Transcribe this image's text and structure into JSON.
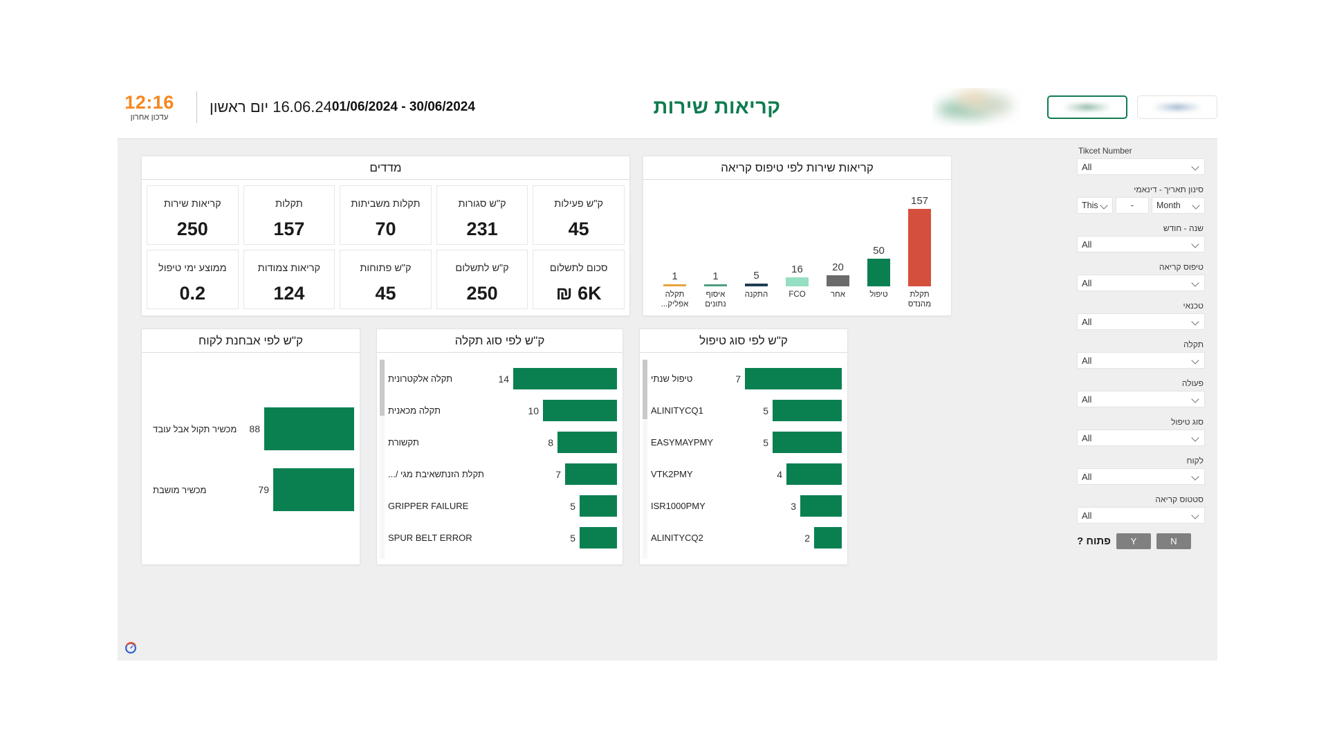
{
  "header": {
    "clock_time": "12:16",
    "clock_sub": "עדכון אחרון",
    "day_date": "16.06.24  יום ראשון",
    "date_range": "01/06/2024 - 30/06/2024",
    "title": "קריאות שירות",
    "button_secondary_label": "",
    "button_primary_label": "",
    "logo_name": "company-logo"
  },
  "kpi": {
    "title": "מדדים",
    "rows": [
      [
        {
          "label": "קריאות שירות",
          "value": "250"
        },
        {
          "label": "תקלות",
          "value": "157"
        },
        {
          "label": "תקלות משביתות",
          "value": "70"
        },
        {
          "label": "ק\"ש סגורות",
          "value": "231"
        },
        {
          "label": "ק\"ש פעילות",
          "value": "45"
        }
      ],
      [
        {
          "label": "ממוצע ימי טיפול",
          "value": "0.2"
        },
        {
          "label": "קריאות צמודות",
          "value": "124"
        },
        {
          "label": "ק\"ש פתוחות",
          "value": "45"
        },
        {
          "label": "ק\"ש לתשלום",
          "value": "250"
        },
        {
          "label": "סכום לתשלום",
          "value": "6K ₪"
        }
      ]
    ]
  },
  "chart_data": [
    {
      "id": "calls-by-type",
      "type": "bar",
      "orientation": "vertical",
      "title": "קריאות שירות לפי טיפוס קריאה",
      "xlabel": "",
      "ylabel": "",
      "ylim": [
        0,
        157
      ],
      "grid": false,
      "legend": "none",
      "categories": [
        "תקלת מהנדס",
        "טיפול",
        "אחר",
        "FCO",
        "התקנה",
        "איסוף נתונים",
        "תקלה אפליק..."
      ],
      "values": [
        157,
        50,
        20,
        16,
        5,
        1,
        1
      ],
      "colors": [
        "#D4503C",
        "#0A8050",
        "#6B6B6B",
        "#96DFC2",
        "#1E3D55",
        "#4F9E7E",
        "#E8A33D"
      ]
    },
    {
      "id": "calls-by-customer-diagnosis",
      "type": "bar",
      "orientation": "horizontal",
      "title": "ק\"ש לפי אבחנת לקוח",
      "xlabel": "",
      "ylabel": "",
      "xlim": [
        0,
        88
      ],
      "grid": false,
      "legend": "none",
      "categories": [
        "מכשיר תקול אבל עובד",
        "מכשיר מושבת"
      ],
      "values": [
        88,
        79
      ],
      "color": "#0A8050"
    },
    {
      "id": "calls-by-fault-type",
      "type": "bar",
      "orientation": "horizontal",
      "title": "ק\"ש לפי סוג תקלה",
      "xlabel": "",
      "ylabel": "",
      "xlim": [
        0,
        14
      ],
      "grid": false,
      "legend": "none",
      "scrollable": true,
      "categories": [
        "תקלה אלקטרונית",
        "תקלה מכאנית",
        "תקשורת",
        "תקלת הזנתשאיבת מגי /...",
        "GRIPPER FAILURE",
        "SPUR BELT ERROR"
      ],
      "values": [
        14,
        10,
        8,
        7,
        5,
        5
      ],
      "color": "#0A8050"
    },
    {
      "id": "calls-by-treatment-type",
      "type": "bar",
      "orientation": "horizontal",
      "title": "ק\"ש לפי סוג טיפול",
      "xlabel": "",
      "ylabel": "",
      "xlim": [
        0,
        7
      ],
      "grid": false,
      "legend": "none",
      "scrollable": true,
      "categories": [
        "טיפול שנתי",
        "ALINITYCQ1",
        "EASYMAYPMY",
        "VTK2PMY",
        "ISR1000PMY",
        "ALINITYCQ2"
      ],
      "values": [
        7,
        5,
        5,
        4,
        3,
        2
      ],
      "color": "#0A8050"
    }
  ],
  "filters": {
    "ticket_number": {
      "label": "Tikcet Number",
      "value": "All"
    },
    "dynamic_date": {
      "label": "סינון תאריך - דינאמי",
      "relative": "This",
      "separator": "-",
      "period": "Month"
    },
    "year_month": {
      "label": "שנה - חודש",
      "value": "All"
    },
    "call_type": {
      "label": "טיפוס קריאה",
      "value": "All"
    },
    "technician": {
      "label": "טכנאי",
      "value": "All"
    },
    "fault": {
      "label": "תקלה",
      "value": "All"
    },
    "action": {
      "label": "פעולה",
      "value": "All"
    },
    "treatment_type": {
      "label": "סוג טיפול",
      "value": "All"
    },
    "customer": {
      "label": "לקוח",
      "value": "All"
    },
    "call_status": {
      "label": "סטטוס קריאה",
      "value": "All"
    },
    "open_toggle": {
      "label": "פתוח ?",
      "no": "N",
      "yes": "Y"
    }
  }
}
